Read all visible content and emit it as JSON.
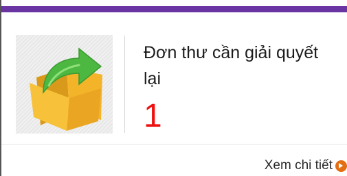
{
  "widget": {
    "title": "Đơn thư cần giải quyết lại",
    "count": "1",
    "details_link": "Xem chi tiết",
    "icon": "folder-reopen-icon"
  },
  "colors": {
    "top_bar": "#6b34a3",
    "count": "#ee1111",
    "folder": "#f0b22a",
    "arrow": "#46b33a",
    "details_icon": "#e46e12"
  }
}
